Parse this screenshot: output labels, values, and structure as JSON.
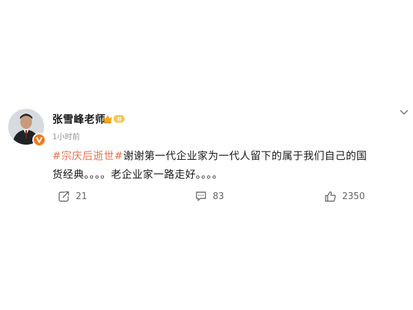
{
  "post": {
    "author": "张雪峰老师",
    "badge_icon": "crown-badge-icon",
    "verified_icon": "verified-v-icon",
    "timestamp": "1小时前",
    "hashtag": "#宗庆后逝世#",
    "text": "谢谢第一代企业家为一代人留下的属于我们自己的国货经典。。。。老企业家一路走好。。。。",
    "menu_icon": "chevron-down-icon"
  },
  "actions": {
    "repost": {
      "icon": "share-icon",
      "count": "21"
    },
    "comment": {
      "icon": "comment-icon",
      "count": "83"
    },
    "like": {
      "icon": "thumbs-up-icon",
      "count": "2350"
    }
  },
  "colors": {
    "hashtag": "#eb7350",
    "badge": "#f5a623",
    "verified": "#f07a1e",
    "text": "#1a1a1a",
    "muted": "#939393"
  }
}
